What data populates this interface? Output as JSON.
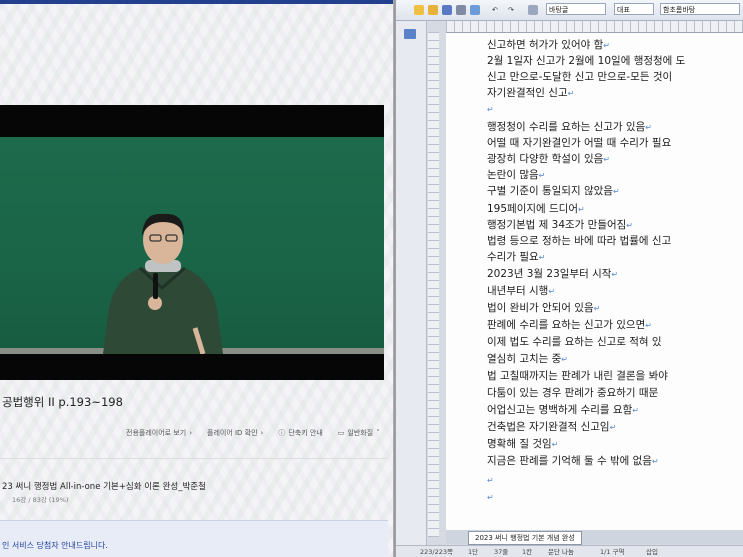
{
  "player": {
    "lecture_title": "공법행위 II  p.193~198",
    "controls": [
      {
        "label": "전용플레이어로 보기",
        "icon": "chevron-right-icon"
      },
      {
        "label": "플레이어 ID 확인",
        "icon": "chevron-right-icon"
      },
      {
        "label": "단축키 안내",
        "icon": "info-icon"
      },
      {
        "label": "일반화질",
        "icon": "monitor-icon"
      }
    ],
    "course_title": "23 써니 행정법 All-in-one 기본+심화 이론 완성_박준철",
    "progress_text": "16강 / 83강 (19%)",
    "notice_text": "인 서비스 당첨자 안내드립니다."
  },
  "editor": {
    "toolbar": {
      "style_combo": "바탕글",
      "font_combo": "대표",
      "face_combo": "함초롬바탕"
    },
    "lines": [
      "신고하면 허가가 있어야 함",
      "2월 1일자 신고가 2월에 10일에 행정청에 도",
      "신고 만으로-도달한 신고 만으로-모든 것이",
      "자기완결적인 신고",
      "",
      "행정청이 수리를 요하는 신고가 있음",
      "어떨 때 자기완결인가 어떨 때 수리가 필요",
      "광장히 다양한 학설이 있음",
      "논란이 많음",
      "구별 기준이 통일되지 않았음",
      "195페이지에 드디어",
      "행정기본법 제 34조가 만들어짐",
      "법령 등으로 정하는 바에 따라 법률에 신고",
      "수리가 필요",
      "2023년 3월 23일부터 시작",
      "내년부터 시행",
      "법이 완비가 안되어 있음",
      "판례에 수리를 요하는 신고가 있으면",
      "이제 법도 수리를 요하는 신고로 적혀 있",
      "열심히 고치는 중",
      "법 고칠때까지는 판례가 내린 결론을 봐야",
      "다툼이 있는 경우 판례가 중요하기 때문",
      "어업신고는 명백하게 수리를 요함",
      "건축법은 자기완결적 신고임",
      "명확해 질 것임",
      "지금은 판례를 기억해 둘 수 밖에 없음",
      "",
      ""
    ],
    "paragraph_mark": "↵",
    "document_tab": "2023 써니 행정법 기본 개념 완성",
    "status": {
      "page": "223/223쪽",
      "section": "1단",
      "line": "37줄",
      "col": "1칸",
      "char": "문단 나눔",
      "zone": "1/1 구역",
      "mode": "삽입"
    }
  },
  "colors": {
    "board_green": "#1d6b4c",
    "link_blue": "#1f3f99",
    "title_bar_blue": "#23408e"
  }
}
